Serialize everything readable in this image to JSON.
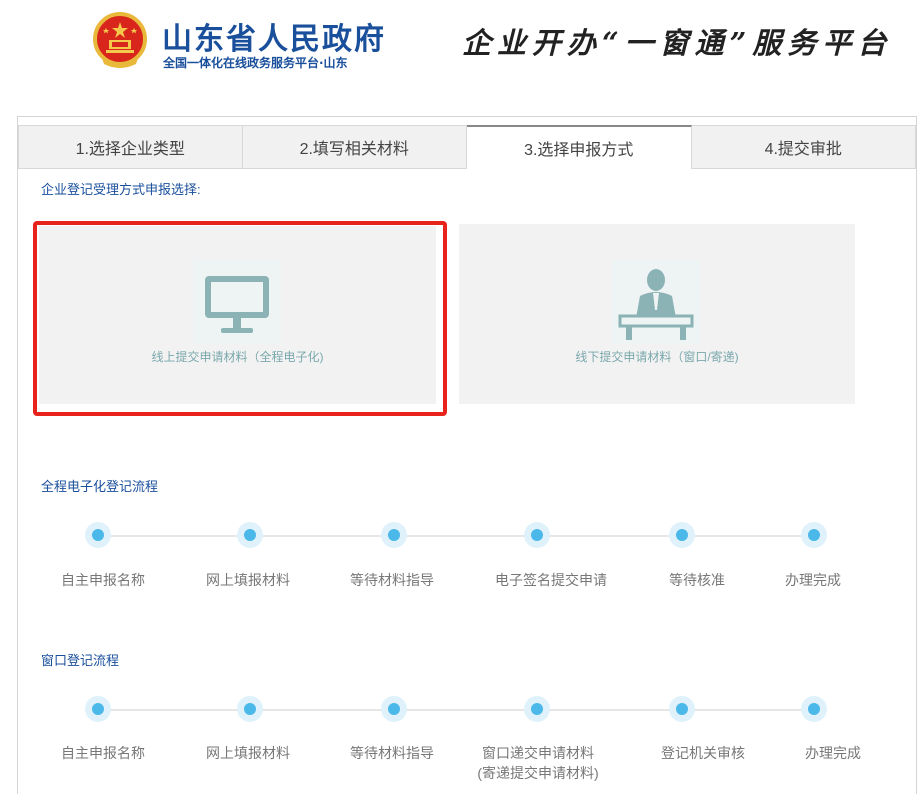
{
  "header": {
    "org_name": "山东省人民政府",
    "org_subtitle": "全国一体化在线政务服务平台·山东",
    "platform_slogan": "企业开办“一窗通”服务平台"
  },
  "tabs": [
    {
      "label": "1.选择企业类型",
      "active": false
    },
    {
      "label": "2.填写相关材料",
      "active": false
    },
    {
      "label": "3.选择申报方式",
      "active": true
    },
    {
      "label": "4.提交审批",
      "active": false
    }
  ],
  "method_section": {
    "label": "企业登记受理方式申报选择:",
    "options": [
      {
        "label": "线上提交申请材料（全程电子化)",
        "icon": "monitor-icon",
        "selected": true
      },
      {
        "label": "线下提交申请材料（窗口/寄递)",
        "icon": "clerk-icon",
        "selected": false
      }
    ]
  },
  "online_flow": {
    "title": "全程电子化登记流程",
    "steps": [
      "自主申报名称",
      "网上填报材料",
      "等待材料指导",
      "电子签名提交申请",
      "等待核准",
      "办理完成"
    ]
  },
  "window_flow": {
    "title": "窗口登记流程",
    "steps": [
      "自主申报名称",
      "网上填报材料",
      "等待材料指导",
      "窗口递交申请材料",
      "登记机关审核",
      "办理完成"
    ],
    "step4_note": "(寄递提交申请材料)"
  },
  "colors": {
    "brand_blue": "#1a4f9c",
    "selection_red": "#e8231c",
    "icon_teal": "#8bb3b6",
    "node_blue": "#4bb8ea"
  }
}
